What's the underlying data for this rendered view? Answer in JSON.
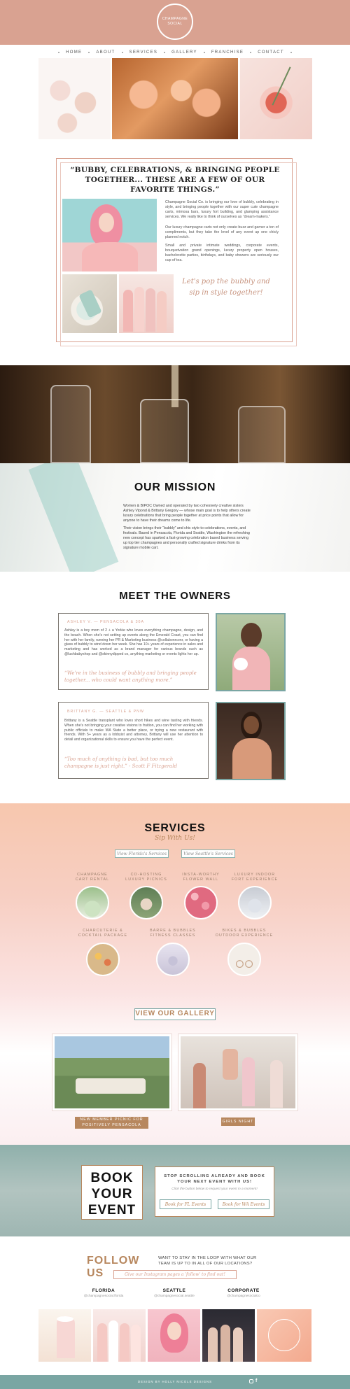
{
  "header": {
    "logo_line1": "CHAMPAGNE",
    "logo_line2": "SOCIAL",
    "nav": [
      "HOME",
      "ABOUT",
      "SERVICES",
      "GALLERY",
      "FRANCHISE",
      "CONTACT"
    ]
  },
  "intro": {
    "heading": "“BUBBY, CELEBRATIONS, & BRINGING PEOPLE TOGETHER... THESE ARE A FEW OF OUR FAVORITE THINGS.”",
    "p1": "Champagne Social Co. is bringing our love of bubbly, celebrating in style, and bringing people together with our super cute champagne carts, mimosa bars, luxury fort building, and glamping assistance services. We really like to think of ourselves as “dream-makers.”",
    "p2": "Our luxury champagne carts not only create buzz and garner a ton of compliments, but they take the level of any event up one chicly planned notch.",
    "p3": "Small and private intimate weddings, corporate events, bouquetvation grand openings, luxury property open houses, bachelorette parties, birthdays, and baby showers are seriously our cup of tea.",
    "script": "Let's pop the bubbly and sip in style together!"
  },
  "mission": {
    "heading": "OUR MISSION",
    "p1": "Women & BIPOC Owned and operated by two cohesively creative sisters Ashley Vipond & Brittany Gregory — whose main goal is to help others create luxury celebrations that bring people together at price points that allow for anyone to have their dreams come to life.",
    "p2": "Their vision brings their “bubbly” and chic style to celebrations, events, and festivals. Based in Pensacola, Florida and Seattle, Washington the refreshing new concept has sparked a fast-growing celebration based business serving up top tier champagnes and personally crafted signature drinks from its signature mobile cart."
  },
  "owners": {
    "heading": "MEET THE OWNERS",
    "o1": {
      "name": "ASHLEY V.  —  PENSACOLA & 30A",
      "bio": "Ashley is a boy mom of 2 + a Yorkie who loves everything champagne, design, and the beach. When she's not setting up events along the Emerald Coast, you can find her with her family, running her PR & Marketing business @collabonrconr, or having a glass of bubbly to wind down her week. She has 10+ years of experience in sales and marketing and has worked as a brand manager for various brands such as @lushbabyshop and @skinnydipped co, anything marketing or events lights her up.",
      "quote": "“We're in the business of bubbly and bringing people together... who could want anything more.”"
    },
    "o2": {
      "name": "BRITTANY G.  —  SEATTLE & PNW",
      "bio": "Brittany is a Seattle transplant who loves short hikes and wine tasting with friends. When she's not bringing your creative visions to fruition, you can find her working with public officials to make WA State a better place, or trying a new restaurant with friends. With 5+ years as a lobbyist and attorney, Brittany will use her attention to detail and organizational skills to ensure you have the perfect event.",
      "quote": "“Too much of anything is bad, but too much champagne is just right.” - Scott F Fitzgerald"
    }
  },
  "services": {
    "heading": "SERVICES",
    "sub": "Sip With Us!",
    "btn1": "View Florida's Services",
    "btn2": "View Seattle's Services",
    "items": [
      {
        "l1": "CHAMPAGNE",
        "l2": "CART RENTAL"
      },
      {
        "l1": "CO-HOSTING",
        "l2": "LUXURY PICNICS"
      },
      {
        "l1": "INSTA-WORTHY",
        "l2": "FLOWER WALL"
      },
      {
        "l1": "LUXURY INDOOR",
        "l2": "FORT EXPERIENCE"
      },
      {
        "l1": "CHARCUTERIE &",
        "l2": "COCKTAIL PACKAGE"
      },
      {
        "l1": "BARRE & BUBBLES",
        "l2": "FITNESS CLASSES"
      },
      {
        "l1": "BIKES & BUBBLES",
        "l2": "OUTDOOR EXPERIENCE"
      }
    ]
  },
  "gallery": {
    "heading": "VIEW OUR GALLERY",
    "cap1a": "NEW MEMBER PICNIC FOR",
    "cap1b": "POSITIVELY PENSACOLA",
    "cap2": "GIRLS NIGHT"
  },
  "book": {
    "title1": "BOOK",
    "title2": "YOUR",
    "title3": "EVENT",
    "text": "STOP SCROLLING ALREADY AND BOOK YOUR NEXT EVENT WITH US!",
    "sub": "Click the button below to request your event in a moment!",
    "btn1": "Book for FL Events",
    "btn2": "Book for WA Events"
  },
  "follow": {
    "heading": "FOLLOW US",
    "text": "WANT TO STAY IN THE LOOP WITH WHAT OUR TEAM IS UP TO IN ALL OF OUR LOCATIONS?",
    "btn": "Give our Instagram pages a 'follow' to find out!",
    "loc1": "FLORIDA",
    "h1": "@champagnesocial.florida",
    "loc2": "SEATTLE",
    "h2": "@champagnesocial.seattle",
    "loc3": "CORPORATE",
    "h3": "@champagnesocialco"
  },
  "footer": {
    "credit": "DESIGN BY HOLLY NICOLE DESIGNS"
  },
  "colors": {
    "accent": "#d9a291",
    "teal": "#7aa6a3",
    "tan": "#b7875e"
  }
}
